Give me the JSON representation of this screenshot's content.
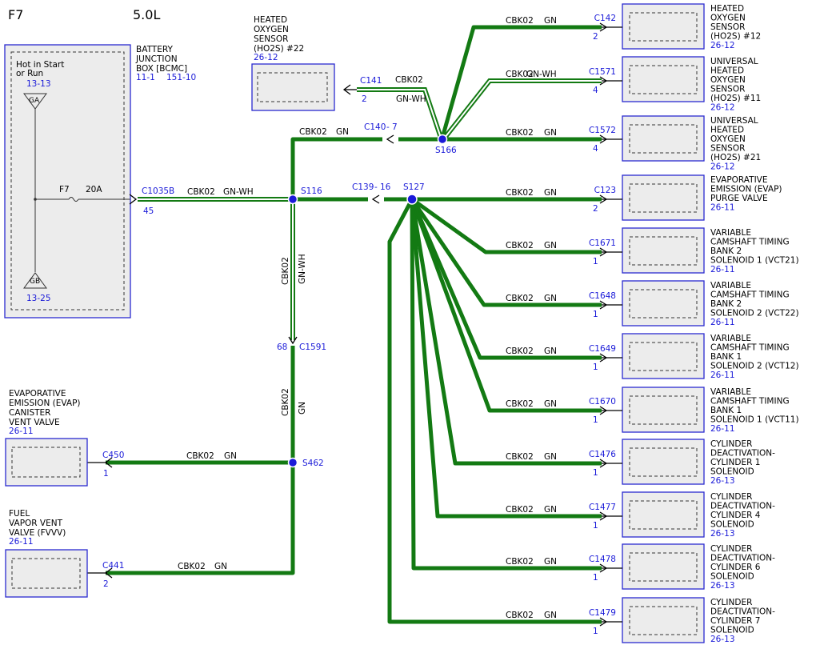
{
  "header": {
    "page": "F7",
    "engine": "5.0L"
  },
  "battery_box": {
    "name_lines": [
      "BATTERY",
      "JUNCTION",
      "BOX [BCMC]"
    ],
    "ref1": "11-1",
    "ref2": "151-10",
    "power_lines": [
      "Hot in Start",
      "or Run"
    ],
    "top_ref": "13-13",
    "top_ground": "GA",
    "bottom_ground": "GB",
    "bottom_ref": "13-25",
    "fuse_name": "F7",
    "fuse_rating": "20A"
  },
  "connectors": {
    "c1035b": "C1035B",
    "c1035b_pin": "45",
    "c140": "C140",
    "c140_pin": "7",
    "c139": "C139",
    "c139_pin": "16",
    "c1591": "C1591",
    "c1591_pin": "68",
    "c141": "C141",
    "c141_pin": "2",
    "c450": "C450",
    "c450_pin": "1",
    "c441": "C441",
    "c441_pin": "2"
  },
  "splices": {
    "s116": "S116",
    "s166": "S166",
    "s127": "S127",
    "s462": "S462"
  },
  "wire_labels": {
    "circuit": "CBK02",
    "gn": "GN",
    "gnwh": "GN-WH",
    "dash": "-"
  },
  "left_components": {
    "ho2s22": {
      "lines": [
        "HEATED",
        "OXYGEN",
        "SENSOR",
        "(HO2S) #22"
      ],
      "ref": "26-12"
    },
    "evap_vent": {
      "lines": [
        "EVAPORATIVE",
        "EMISSION (EVAP)",
        "CANISTER",
        "VENT VALVE"
      ],
      "ref": "26-11"
    },
    "fvvv": {
      "lines": [
        "FUEL",
        "VAPOR VENT",
        "VALVE (FVVV)"
      ],
      "ref": "26-11"
    }
  },
  "right_components": [
    {
      "connector": "C142",
      "pin": "2",
      "wire": "GN",
      "lines": [
        "HEATED",
        "OXYGEN",
        "SENSOR",
        "(HO2S) #12"
      ],
      "ref": "26-12"
    },
    {
      "connector": "C1571",
      "pin": "4",
      "wire": "GN-WH",
      "lines": [
        "UNIVERSAL",
        "HEATED",
        "OXYGEN",
        "SENSOR",
        "(HO2S) #11"
      ],
      "ref": "26-12"
    },
    {
      "connector": "C1572",
      "pin": "4",
      "wire": "GN",
      "lines": [
        "UNIVERSAL",
        "HEATED",
        "OXYGEN",
        "SENSOR",
        "(HO2S) #21"
      ],
      "ref": "26-12"
    },
    {
      "connector": "C123",
      "pin": "2",
      "wire": "GN",
      "lines": [
        "EVAPORATIVE",
        "EMISSION (EVAP)",
        "PURGE VALVE"
      ],
      "ref": "26-11"
    },
    {
      "connector": "C1671",
      "pin": "1",
      "wire": "GN",
      "lines": [
        "VARIABLE",
        "CAMSHAFT TIMING",
        "BANK 2",
        "SOLENOID 1 (VCT21)"
      ],
      "ref": "26-11"
    },
    {
      "connector": "C1648",
      "pin": "1",
      "wire": "GN",
      "lines": [
        "VARIABLE",
        "CAMSHAFT TIMING",
        "BANK 2",
        "SOLENOID 2 (VCT22)"
      ],
      "ref": "26-11"
    },
    {
      "connector": "C1649",
      "pin": "1",
      "wire": "GN",
      "lines": [
        "VARIABLE",
        "CAMSHAFT TIMING",
        "BANK 1",
        "SOLENOID 2 (VCT12)"
      ],
      "ref": "26-11"
    },
    {
      "connector": "C1670",
      "pin": "1",
      "wire": "GN",
      "lines": [
        "VARIABLE",
        "CAMSHAFT TIMING",
        "BANK 1",
        "SOLENOID 1 (VCT11)"
      ],
      "ref": "26-11"
    },
    {
      "connector": "C1476",
      "pin": "1",
      "wire": "GN",
      "lines": [
        "CYLINDER",
        "DEACTIVATION-",
        "CYLINDER 1",
        "SOLENOID"
      ],
      "ref": "26-13"
    },
    {
      "connector": "C1477",
      "pin": "1",
      "wire": "GN",
      "lines": [
        "CYLINDER",
        "DEACTIVATION-",
        "CYLINDER 4",
        "SOLENOID"
      ],
      "ref": "26-13"
    },
    {
      "connector": "C1478",
      "pin": "1",
      "wire": "GN",
      "lines": [
        "CYLINDER",
        "DEACTIVATION-",
        "CYLINDER 6",
        "SOLENOID"
      ],
      "ref": "26-13"
    },
    {
      "connector": "C1479",
      "pin": "1",
      "wire": "GN",
      "lines": [
        "CYLINDER",
        "DEACTIVATION-",
        "CYLINDER 7",
        "SOLENOID"
      ],
      "ref": "26-13"
    }
  ],
  "colors": {
    "wire": "#137a13",
    "ref": "#1a1ad8",
    "box_border": "#2a2ad0",
    "box_fill": "#ececec"
  }
}
